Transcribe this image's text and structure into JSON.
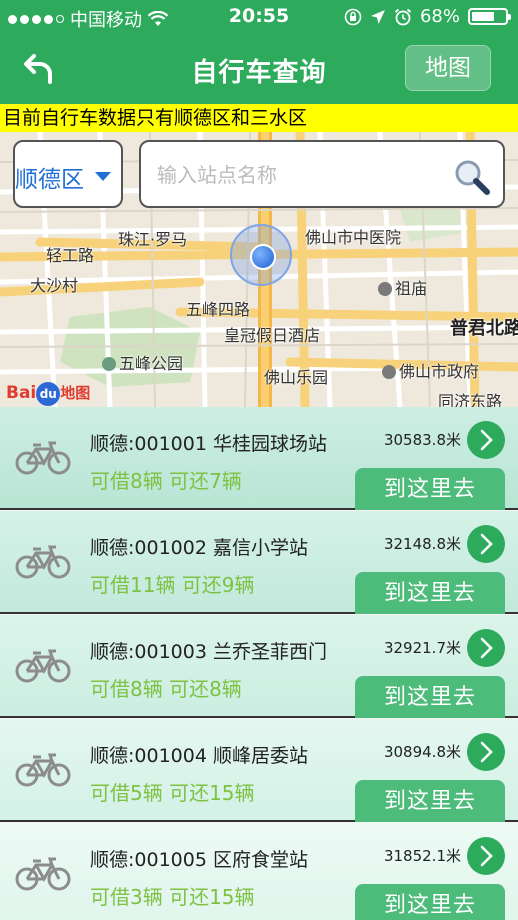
{
  "status_bar": {
    "carrier": "中国移动",
    "time": "20:55",
    "battery_percent": "68%",
    "battery_level": 0.68,
    "icons": [
      "signal-dots-icon",
      "wifi-icon",
      "rotation-lock-icon",
      "location-arrow-icon",
      "alarm-icon",
      "battery-icon"
    ]
  },
  "nav": {
    "back_icon": "back-arrow-icon",
    "title": "自行车查询",
    "map_button": "地图"
  },
  "notice": "目前自行车数据只有顺德区和三水区",
  "search": {
    "district": "顺德区",
    "placeholder": "输入站点名称",
    "icon": "magnifier-icon"
  },
  "map": {
    "labels": [
      "珠江·罗马",
      "佛山市中医院",
      "轻工路",
      "大沙村",
      "五峰四路",
      "祖庙",
      "普君北路",
      "皇冠假日酒店",
      "五峰公园",
      "佛山乐园",
      "佛山市政府",
      "同济东路"
    ],
    "logo": {
      "bai": "Bai",
      "du": "du",
      "map": "地图"
    },
    "colors": {
      "road_major": "#f7d27a",
      "road_minor": "#ffffff",
      "land": "#efe9dd",
      "park": "#cfe3c0"
    }
  },
  "stations": [
    {
      "name": "顺德:001001 华桂园球场站",
      "available": "可借8辆 可还7辆",
      "distance": "30583.8米",
      "go_label": "到这里去"
    },
    {
      "name": "顺德:001002 嘉信小学站",
      "available": "可借11辆 可还9辆",
      "distance": "32148.8米",
      "go_label": "到这里去"
    },
    {
      "name": "顺德:001003 兰乔圣菲西门",
      "available": "可借8辆 可还8辆",
      "distance": "32921.7米",
      "go_label": "到这里去"
    },
    {
      "name": "顺德:001004 顺峰居委站",
      "available": "可借5辆 可还15辆",
      "distance": "30894.8米",
      "go_label": "到这里去"
    },
    {
      "name": "顺德:001005 区府食堂站",
      "available": "可借3辆 可还15辆",
      "distance": "31852.1米",
      "go_label": "到这里去"
    }
  ],
  "theme": {
    "primary": "#2eaa5c",
    "available_text": "#7dc243",
    "district_text": "#1f6fd6",
    "notice_bg": "#ffff00"
  }
}
